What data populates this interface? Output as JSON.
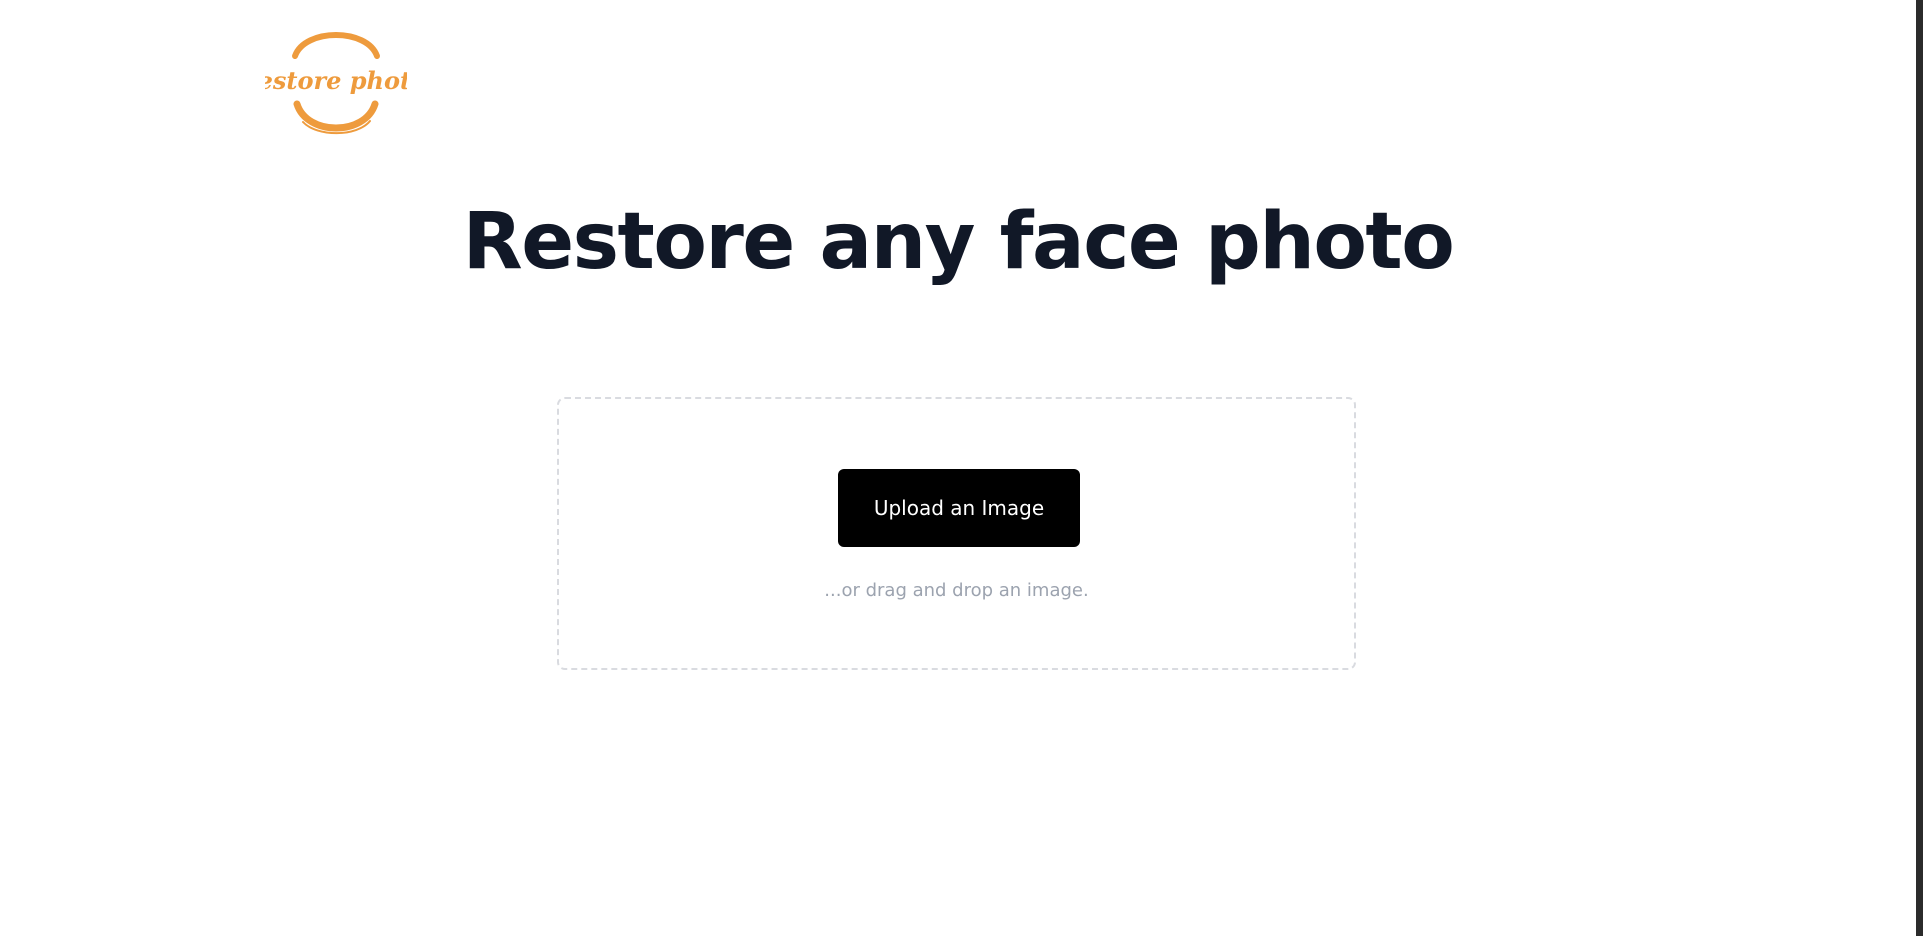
{
  "logo": {
    "text": "restore photo",
    "color": "#ee9b3d"
  },
  "hero": {
    "title": "Restore any face photo"
  },
  "upload": {
    "button_label": "Upload an Image",
    "hint": "...or drag and drop an image."
  },
  "colors": {
    "title": "#111827",
    "button_bg": "#000000",
    "button_text": "#ffffff",
    "hint": "#9ca3af",
    "dropzone_border": "#d9dbe0"
  }
}
